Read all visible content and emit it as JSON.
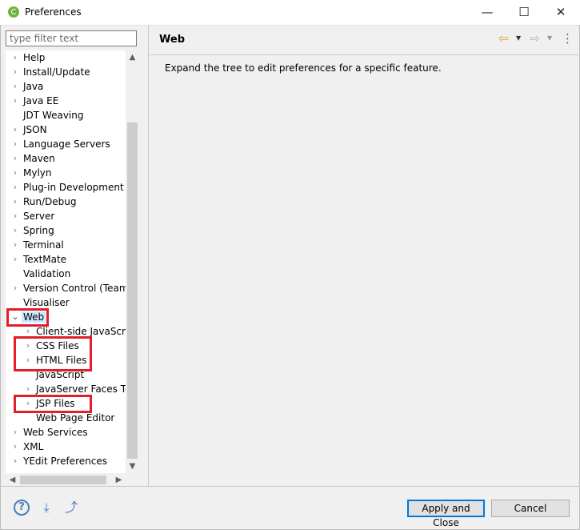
{
  "window": {
    "title": "Preferences",
    "minimize": "—",
    "maximize": "☐",
    "close": "✕"
  },
  "filter": {
    "placeholder": "type filter text"
  },
  "tree": {
    "items": [
      {
        "label": "Help",
        "expander": "›"
      },
      {
        "label": "Install/Update",
        "expander": "›"
      },
      {
        "label": "Java",
        "expander": "›"
      },
      {
        "label": "Java EE",
        "expander": "›"
      },
      {
        "label": "JDT Weaving",
        "expander": ""
      },
      {
        "label": "JSON",
        "expander": "›"
      },
      {
        "label": "Language Servers",
        "expander": "›"
      },
      {
        "label": "Maven",
        "expander": "›"
      },
      {
        "label": "Mylyn",
        "expander": "›"
      },
      {
        "label": "Plug-in Development",
        "expander": "›"
      },
      {
        "label": "Run/Debug",
        "expander": "›"
      },
      {
        "label": "Server",
        "expander": "›"
      },
      {
        "label": "Spring",
        "expander": "›"
      },
      {
        "label": "Terminal",
        "expander": "›"
      },
      {
        "label": "TextMate",
        "expander": "›"
      },
      {
        "label": "Validation",
        "expander": ""
      },
      {
        "label": "Version Control (Team)",
        "expander": "›"
      },
      {
        "label": "Visualiser",
        "expander": ""
      },
      {
        "label": "Web",
        "expander": "⌄",
        "selected": true
      },
      {
        "label": "Client-side JavaScript",
        "expander": "›",
        "child": true
      },
      {
        "label": "CSS Files",
        "expander": "›",
        "child": true
      },
      {
        "label": "HTML Files",
        "expander": "›",
        "child": true
      },
      {
        "label": "JavaScript",
        "expander": "",
        "child": true
      },
      {
        "label": "JavaServer Faces Tools",
        "expander": "›",
        "child": true
      },
      {
        "label": "JSP Files",
        "expander": "›",
        "child": true
      },
      {
        "label": "Web Page Editor",
        "expander": "",
        "child": true
      },
      {
        "label": "Web Services",
        "expander": "›"
      },
      {
        "label": "XML",
        "expander": "›"
      },
      {
        "label": "YEdit Preferences",
        "expander": "›"
      }
    ],
    "scroll_up": "▲",
    "scroll_down": "▼",
    "scroll_left": "◀",
    "scroll_right": "▶"
  },
  "page": {
    "title": "Web",
    "description": "Expand the tree to edit preferences for a specific feature.",
    "back_icon": "⇦",
    "forward_icon": "⇨",
    "dropdown": "▼",
    "menu_icon": "⋮"
  },
  "footer": {
    "help_label": "?",
    "import_icon": "⤓",
    "export_icon": "⤴",
    "apply_close_label": "Apply and Close",
    "cancel_label": "Cancel"
  },
  "colors": {
    "highlight_box": "#e21d2c",
    "selection": "#cce8ff",
    "default_button_border": "#0078d7",
    "spring_green": "#6db33f"
  }
}
